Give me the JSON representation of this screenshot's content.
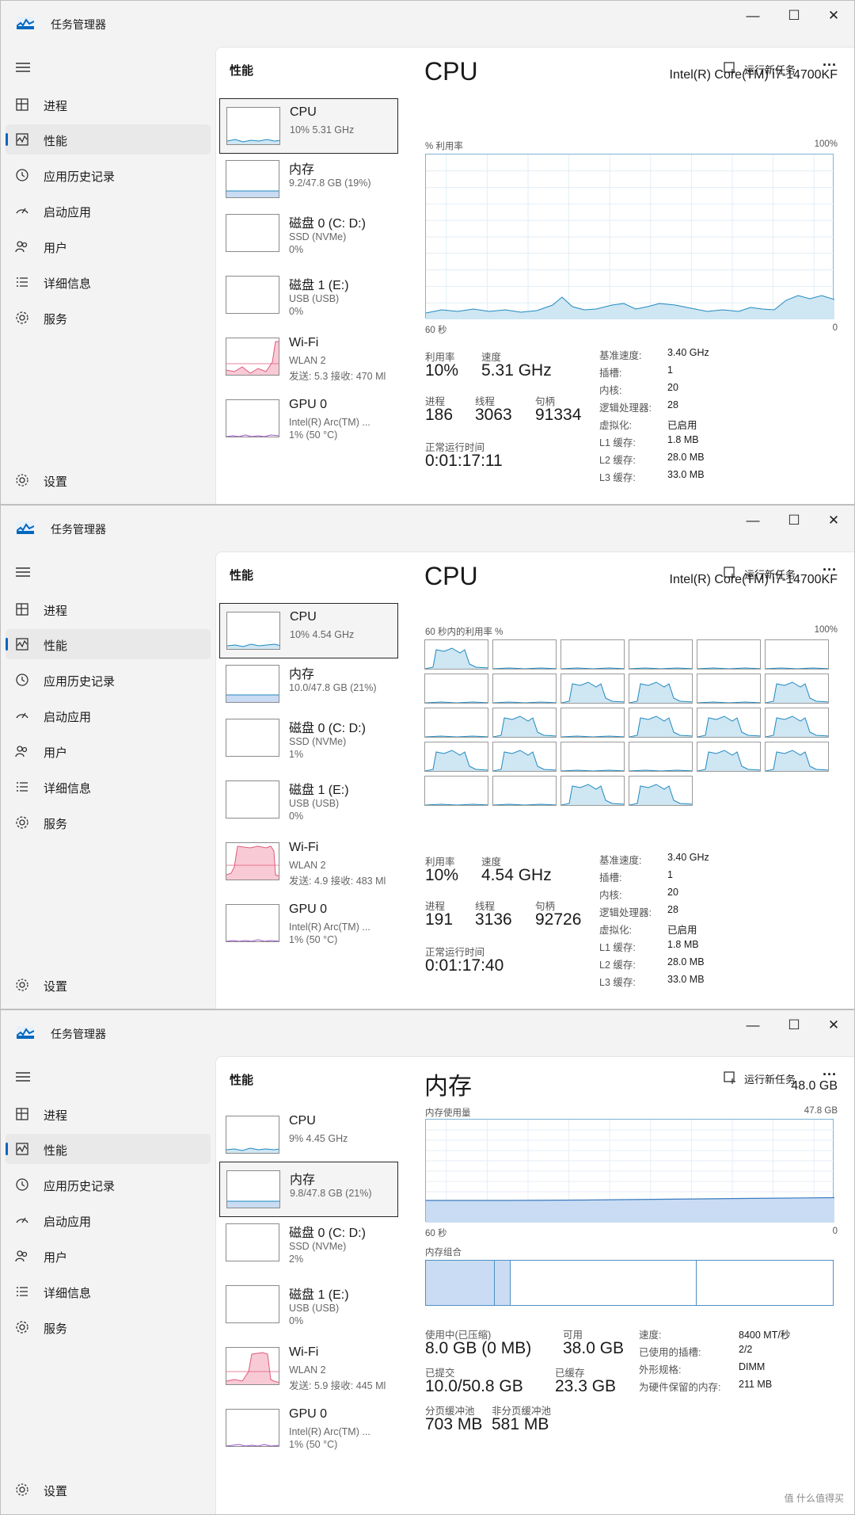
{
  "colors": {
    "cpu_line": "#1f8ac0",
    "cpu_fill": "#cfe6f3",
    "wifi_line": "#e05b7b",
    "wifi_fill": "#f8cad6",
    "gpu_line": "#9b54c9",
    "accent": "#0067c0",
    "mem_fill": "#c9dcf3"
  },
  "icons": {
    "app": "task-manager-icon",
    "menu": "hamburger-icon",
    "run": "run-task-icon",
    "more": "more-icon"
  },
  "common": {
    "app_title": "任务管理器",
    "minimize": "—",
    "maximize": "☐",
    "close": "✕",
    "page_title": "性能",
    "run_task": "运行新任务",
    "more": "···",
    "nav": [
      "进程",
      "性能",
      "应用历史记录",
      "启动应用",
      "用户",
      "详细信息",
      "服务"
    ],
    "settings": "设置"
  },
  "cpu_kv_labels": [
    "基准速度:",
    "插槽:",
    "内核:",
    "逻辑处理器:",
    "虚拟化:",
    "L1 缓存:",
    "L2 缓存:",
    "L3 缓存:"
  ],
  "cpu_kv_values": [
    "3.40 GHz",
    "1",
    "20",
    "28",
    "已启用",
    "1.8 MB",
    "28.0 MB",
    "33.0 MB"
  ],
  "cpu_stat_labels": {
    "util": "利用率",
    "speed": "速度",
    "proc": "进程",
    "threads": "线程",
    "handles": "句柄",
    "uptime": "正常运行时间"
  },
  "devices_common": {
    "cpu": "CPU",
    "mem": "内存",
    "disk0": "磁盘 0 (C: D:)",
    "disk0_type": "SSD (NVMe)",
    "disk1": "磁盘 1 (E:)",
    "disk1_type": "USB (USB)",
    "wifi": "Wi-Fi",
    "wifi_type": "WLAN 2",
    "gpu": "GPU 0",
    "gpu_type": "Intel(R) Arc(TM) ..."
  },
  "w1": {
    "cpu_sub": "10% 5.31 GHz",
    "mem_sub": "9.2/47.8 GB (19%)",
    "disk0_pct": "0%",
    "disk1_pct": "0%",
    "wifi_sub": "发送: 5.3 接收: 470 Ml",
    "gpu_sub": "1% (50 °C)",
    "title": "CPU",
    "model": "Intel(R) Core(TM) i7-14700KF",
    "graph_label": "% 利用率",
    "graph_max": "100%",
    "graph_time": "60 秒",
    "graph_zero": "0",
    "util": "10%",
    "speed": "5.31 GHz",
    "proc": "186",
    "threads": "3063",
    "handles": "91334",
    "uptime": "0:01:17:11"
  },
  "w2": {
    "cpu_sub": "10% 4.54 GHz",
    "mem_sub": "10.0/47.8 GB (21%)",
    "disk0_pct": "1%",
    "disk1_pct": "0%",
    "wifi_sub": "发送: 4.9 接收: 483 Ml",
    "gpu_sub": "1% (50 °C)",
    "title": "CPU",
    "model": "Intel(R) Core(TM) i7-14700KF",
    "graph_label": "60 秒内的利用率 %",
    "graph_max": "100%",
    "util": "10%",
    "speed": "4.54 GHz",
    "proc": "191",
    "threads": "3136",
    "handles": "92726",
    "uptime": "0:01:17:40"
  },
  "w3": {
    "cpu_sub": "9% 4.45 GHz",
    "mem_sub": "9.8/47.8 GB (21%)",
    "disk0_pct": "2%",
    "disk1_pct": "0%",
    "wifi_sub": "发送: 5.9 接收: 445 Ml",
    "gpu_sub": "1% (50 °C)",
    "title": "内存",
    "total": "48.0 GB",
    "graph_label": "内存使用量",
    "graph_max": "47.8 GB",
    "graph_time": "60 秒",
    "graph_zero": "0",
    "comp_label": "内存组合",
    "in_use_label": "使用中(已压缩)",
    "in_use": "8.0 GB (0 MB)",
    "avail_label": "可用",
    "avail": "38.0 GB",
    "commit_label": "已提交",
    "commit": "10.0/50.8 GB",
    "cached_label": "已缓存",
    "cached": "23.3 GB",
    "paged_label": "分页缓冲池",
    "paged": "703 MB",
    "nonpaged_label": "非分页缓冲池",
    "nonpaged": "581 MB",
    "kv_labels": [
      "速度:",
      "已使用的插槽:",
      "外形规格:",
      "为硬件保留的内存:"
    ],
    "kv_values": [
      "8400 MT/秒",
      "2/2",
      "DIMM",
      "211 MB"
    ]
  },
  "watermark": "值 什么值得买"
}
